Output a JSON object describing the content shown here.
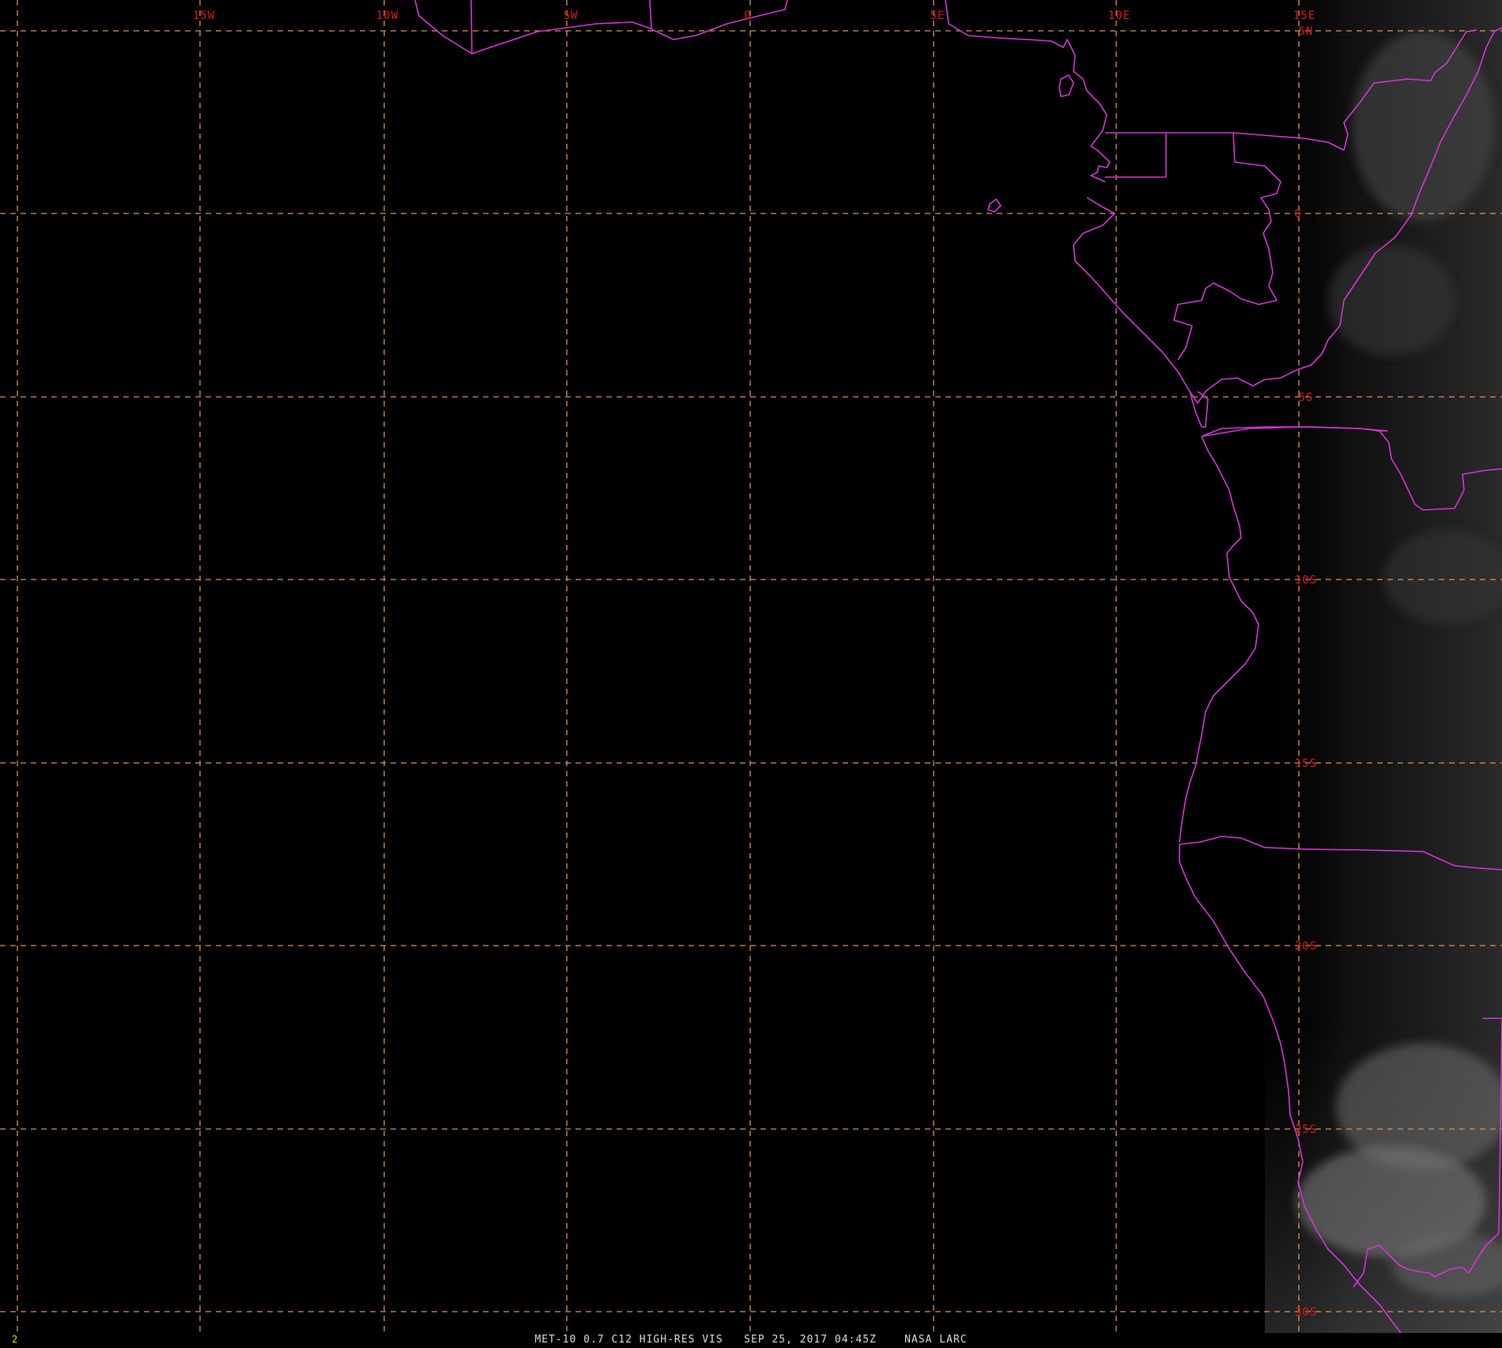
{
  "image": {
    "caption": "MET-10 0.7 C12 HIGH-RES VIS   SEP 25, 2017 04:45Z    NASA LARC",
    "frame_number": "2"
  },
  "grid": {
    "longitude_labels": [
      "15W",
      "10W",
      "5W",
      "0",
      "5E",
      "10E",
      "15E"
    ],
    "latitude_labels": [
      "5N",
      "0",
      "5S",
      "10S",
      "15S",
      "20S",
      "25S",
      "30S"
    ]
  },
  "colors": {
    "background": "#000000",
    "grid": "#d9915a",
    "borders": "#d633d6",
    "grid_labels": "#d81a1a",
    "caption": "#d8d8d8",
    "frame_number": "#e8e000"
  }
}
